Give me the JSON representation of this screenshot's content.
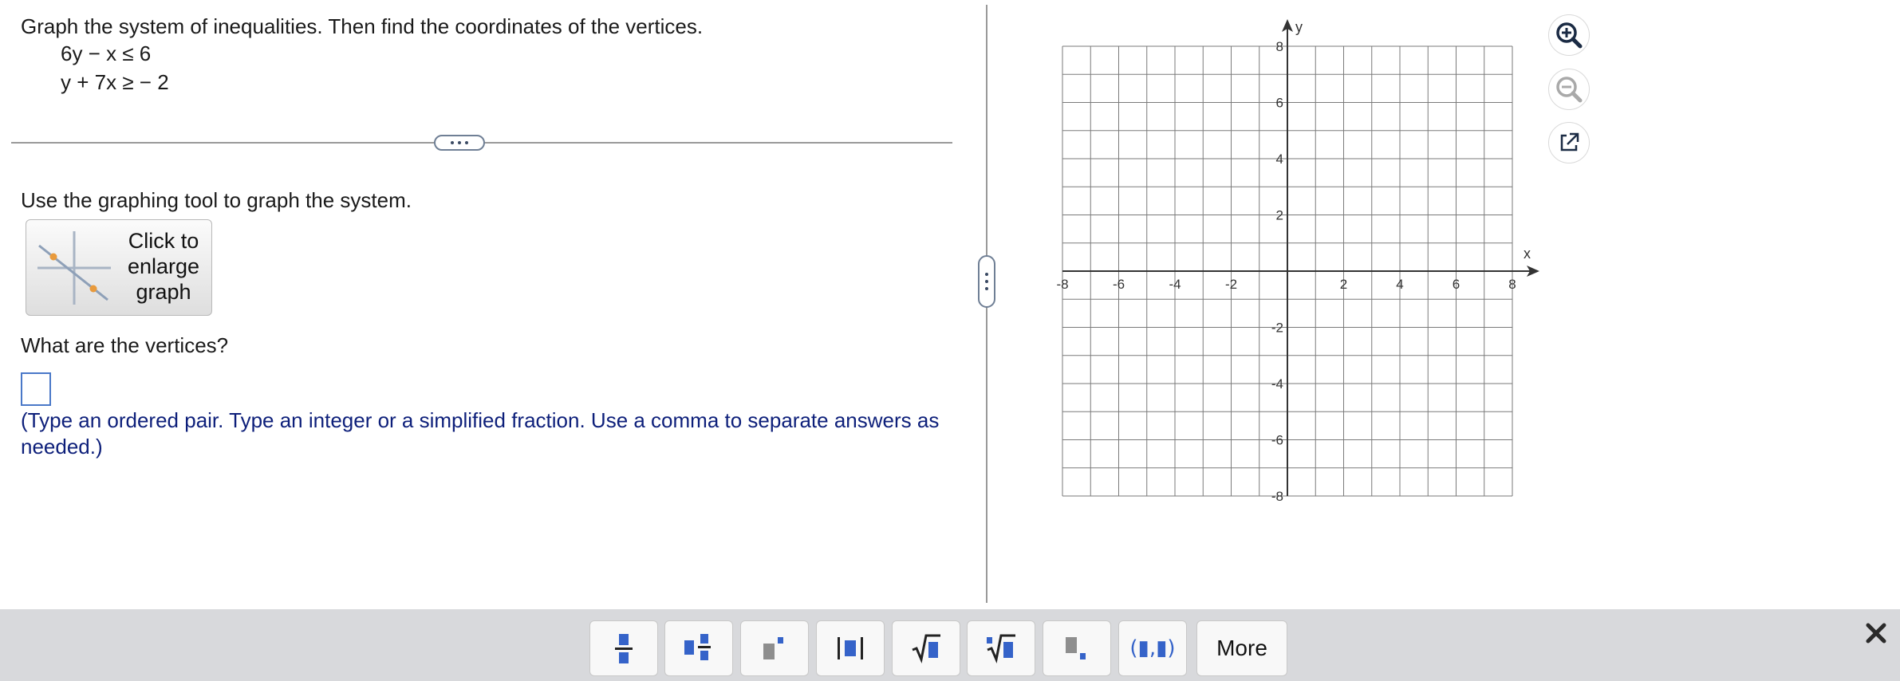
{
  "question": {
    "title": "Graph the system of inequalities. Then find the coordinates of the vertices.",
    "inequalities": [
      "6y − x ≤ 6",
      "y + 7x ≥ − 2"
    ]
  },
  "instruction": "Use the graphing tool to graph the system.",
  "enlarge_button": {
    "label": "Click to\nenlarge\ngraph"
  },
  "vertices_question": "What are the vertices?",
  "answer": {
    "value": ""
  },
  "hint": "(Type an ordered pair. Type an integer or a simplified fraction. Use a comma to separate answers as needed.)",
  "graph": {
    "x_label": "x",
    "y_label": "y",
    "x_min": -8,
    "x_max": 8,
    "y_min": -8,
    "y_max": 8,
    "grid_step": 1,
    "x_tick_labels": [
      "-8",
      "-6",
      "-4",
      "-2",
      "2",
      "4",
      "6",
      "8"
    ],
    "y_tick_labels": [
      "8",
      "6",
      "4",
      "2",
      "-2",
      "-4",
      "-6",
      "-8"
    ]
  },
  "graph_tools": [
    "zoom-in-icon",
    "zoom-out-icon",
    "external-link-icon"
  ],
  "toolbar": {
    "buttons": [
      "fraction",
      "mixed-number",
      "exponent",
      "absolute-value",
      "square-root",
      "nth-root",
      "subscript",
      "ordered-pair"
    ],
    "ordered_pair_label": "(▮,▮)",
    "more_label": "More"
  },
  "colors": {
    "accent": "#3563c9",
    "hint_text": "#0d1f7a",
    "answer_border": "#4a78c8"
  }
}
